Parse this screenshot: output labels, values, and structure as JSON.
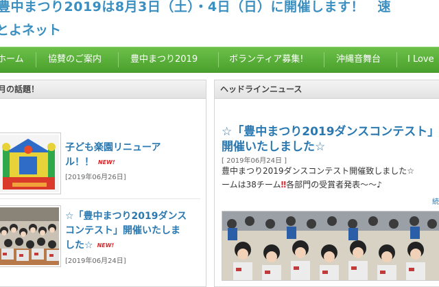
{
  "header": {
    "title": "豊中まつり2019は8月3日（土）・4日（日）に開催します！　速",
    "site_name": "とよネット"
  },
  "nav": {
    "items": [
      "ホーム",
      "協賛のご案内",
      "豊中まつり2019",
      "ボランティア募集!",
      "沖縄音舞台",
      "I Love"
    ]
  },
  "topics": {
    "heading": "月の話題！",
    "items": [
      {
        "title": "子ども楽園リニューアル！！",
        "badge": "NEW!",
        "date": "[2019年06月26日]"
      },
      {
        "title": "☆「豊中まつり2019ダンスコンテスト」開催いたしました☆",
        "badge": "NEW!",
        "date": "[2019年06月24日]"
      }
    ]
  },
  "headline": {
    "heading": "ヘッドラインニュース",
    "title": "☆「豊中まつり2019ダンスコンテスト」開催いたしました☆",
    "date": "[ 2019年06月24日 ]",
    "body_line1": "豊中まつり2019ダンスコンテスト開催致しました☆",
    "body_line2_a": "ームは38チーム",
    "body_line2_excl": "‼",
    "body_line2_b": "各部門の受賞者発表〜〜♪",
    "more": "続"
  },
  "colors": {
    "title_blue": "#3a8fc0",
    "link_blue": "#2a78b0",
    "nav_green": "#5cb23a",
    "badge_red": "#d8262a"
  }
}
